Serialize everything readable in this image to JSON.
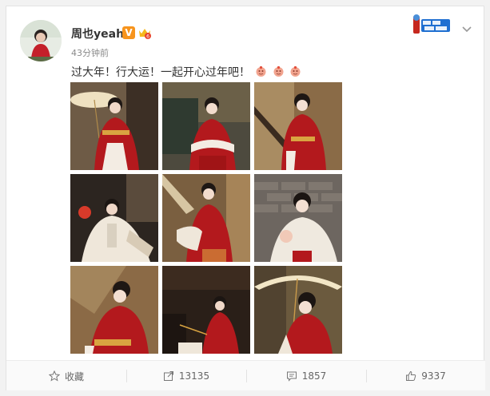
{
  "post": {
    "username": "周也yeah",
    "verified_badge": "V",
    "timestamp": "43分钟前",
    "text": "过大年！行大运！一起开心过年吧！",
    "emoji_icons": [
      "red-envelope-icon",
      "red-envelope-icon",
      "red-envelope-icon"
    ],
    "photos": [
      {
        "name": "photo-1"
      },
      {
        "name": "photo-2"
      },
      {
        "name": "photo-3"
      },
      {
        "name": "photo-4"
      },
      {
        "name": "photo-5"
      },
      {
        "name": "photo-6"
      },
      {
        "name": "photo-7"
      },
      {
        "name": "photo-8"
      },
      {
        "name": "photo-9"
      }
    ]
  },
  "actions": {
    "favorite_label": "收藏",
    "repost_count": "13135",
    "comment_count": "1857",
    "like_count": "9337"
  },
  "colors": {
    "accent_red": "#b3191d",
    "badge_orange": "#f7941d",
    "text": "#333333",
    "muted": "#8a8a8a"
  }
}
